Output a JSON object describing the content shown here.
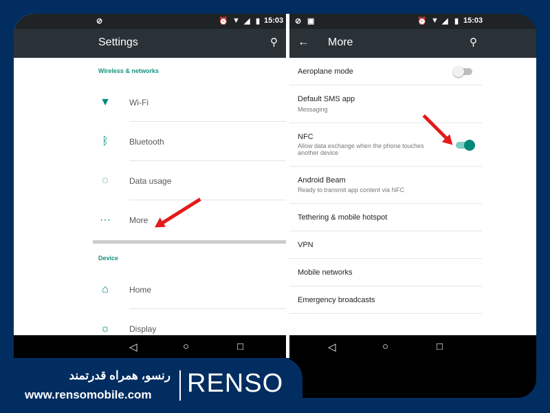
{
  "status": {
    "time": "15:03"
  },
  "left": {
    "title": "Settings",
    "section_wireless": "Wireless & networks",
    "items": [
      {
        "label": "Wi-Fi"
      },
      {
        "label": "Bluetooth"
      },
      {
        "label": "Data usage"
      },
      {
        "label": "More"
      }
    ],
    "section_device": "Device",
    "device_items": [
      {
        "label": "Home"
      },
      {
        "label": "Display"
      }
    ]
  },
  "right": {
    "title": "More",
    "items": [
      {
        "title": "Aeroplane mode",
        "toggle": false
      },
      {
        "title": "Default SMS app",
        "subtitle": "Messaging"
      },
      {
        "title": "NFC",
        "subtitle": "Allow data exchange when the phone touches another device",
        "toggle": true
      },
      {
        "title": "Android Beam",
        "subtitle": "Ready to transmit app content via NFC"
      },
      {
        "title": "Tethering & mobile hotspot"
      },
      {
        "title": "VPN"
      },
      {
        "title": "Mobile networks"
      },
      {
        "title": "Emergency broadcasts"
      }
    ]
  },
  "brand": {
    "tagline": "رنسو، همراه قدرتمند",
    "url": "www.rensomobile.com",
    "logo": "RENSO"
  },
  "colors": {
    "accent": "#009688",
    "background": "#022d60",
    "arrow": "#e41a1a"
  }
}
